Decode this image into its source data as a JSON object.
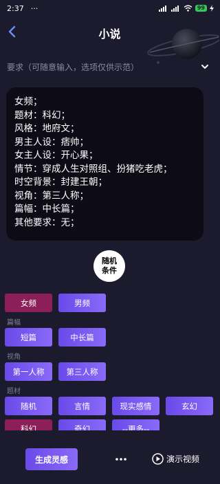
{
  "status_bar": {
    "time": "2:37",
    "dots": "···",
    "battery": "99",
    "signal_label": "4G"
  },
  "header": {
    "title": "小说"
  },
  "requirement": {
    "hint": "要求（可随意输入，选项仅供示范）"
  },
  "prompt": {
    "lines": [
      "女频；",
      "题材：科幻；",
      "风格：地府文；",
      "男主人设：痞帅；",
      "女主人设：开心果；",
      "情节：穿成人生对照组、扮猪吃老虎；",
      "时空背景：封建王朝；",
      "视角：第三人称；",
      "篇幅：中长篇；",
      "其他要求：无；"
    ]
  },
  "random_button": {
    "line1": "随机",
    "line2": "条件"
  },
  "options": {
    "gender": {
      "items": [
        "女频",
        "男频"
      ],
      "selected": "女频"
    },
    "length": {
      "label": "篇幅",
      "items": [
        "短篇",
        "中长篇"
      ]
    },
    "perspective": {
      "label": "视角",
      "items": [
        "第一人称",
        "第三人称"
      ]
    },
    "theme": {
      "label": "题材",
      "items": [
        "随机",
        "言情",
        "现实感情",
        "玄幻",
        "科幻",
        "奇幻",
        "--更多--"
      ]
    }
  },
  "bottom_bar": {
    "generate_label": "生成灵感",
    "demo_label": "演示视频"
  },
  "colors": {
    "background": "#1c1b2e",
    "card": "#0c0b16",
    "selected_chip": "#8c1f5a",
    "accent_chip": "#7a5af0"
  }
}
